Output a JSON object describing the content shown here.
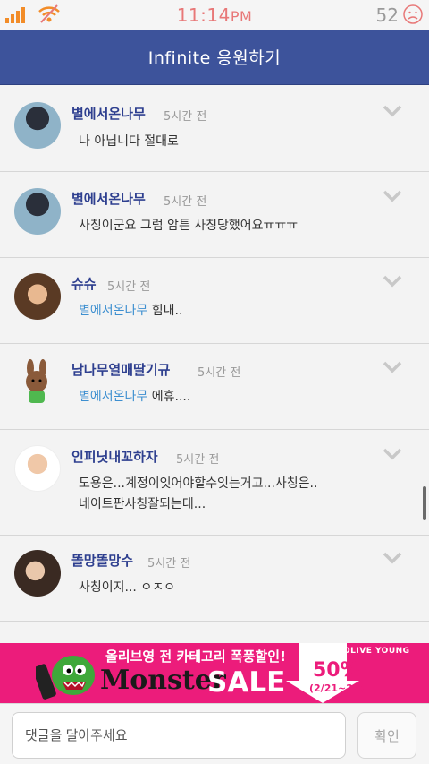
{
  "status": {
    "time": "11:14",
    "ampm": "PM",
    "battery": "52"
  },
  "header": {
    "title": "Infinite 응원하기"
  },
  "comments": [
    {
      "name": "별에서온나무",
      "time": "5시간 전",
      "mention": "",
      "text": "나 아닙니다 절대로",
      "text2": ""
    },
    {
      "name": "별에서온나무",
      "time": "5시간 전",
      "mention": "",
      "text": "사칭이군요 그럼 암튼 사칭당했어요ㅠㅠㅠ",
      "text2": ""
    },
    {
      "name": "슈슈",
      "time": "5시간 전",
      "mention": "별에서온나무",
      "text": " 힘내..",
      "text2": ""
    },
    {
      "name": "남나무열매딸기규",
      "time": "5시간 전",
      "mention": "별에서온나무",
      "text": " 에휴....",
      "text2": ""
    },
    {
      "name": "인피닛내꼬하자",
      "time": "5시간 전",
      "mention": "",
      "text": "도용은...계정이잇어야할수잇는거고...사칭은..",
      "text2": "네이트판사칭잘되는데..."
    },
    {
      "name": "똘망똘망수",
      "time": "5시간 전",
      "mention": "",
      "text": "사칭이지... ㅇㅈㅇ",
      "text2": ""
    }
  ],
  "ad": {
    "brand": "올리브영 전 카테고리 폭풍할인!",
    "monster": "Monster",
    "sale": "SALE",
    "percent": "50%",
    "dates": "(2/21~27)",
    "logo": "OLIVE YOUNG"
  },
  "input": {
    "placeholder": "댓글을 달아주세요",
    "submit_label": "확인"
  },
  "colors": {
    "header": "#3d539b",
    "name": "#2e3f8f",
    "mention": "#3d8fd0",
    "ad": "#ec1c7b"
  }
}
